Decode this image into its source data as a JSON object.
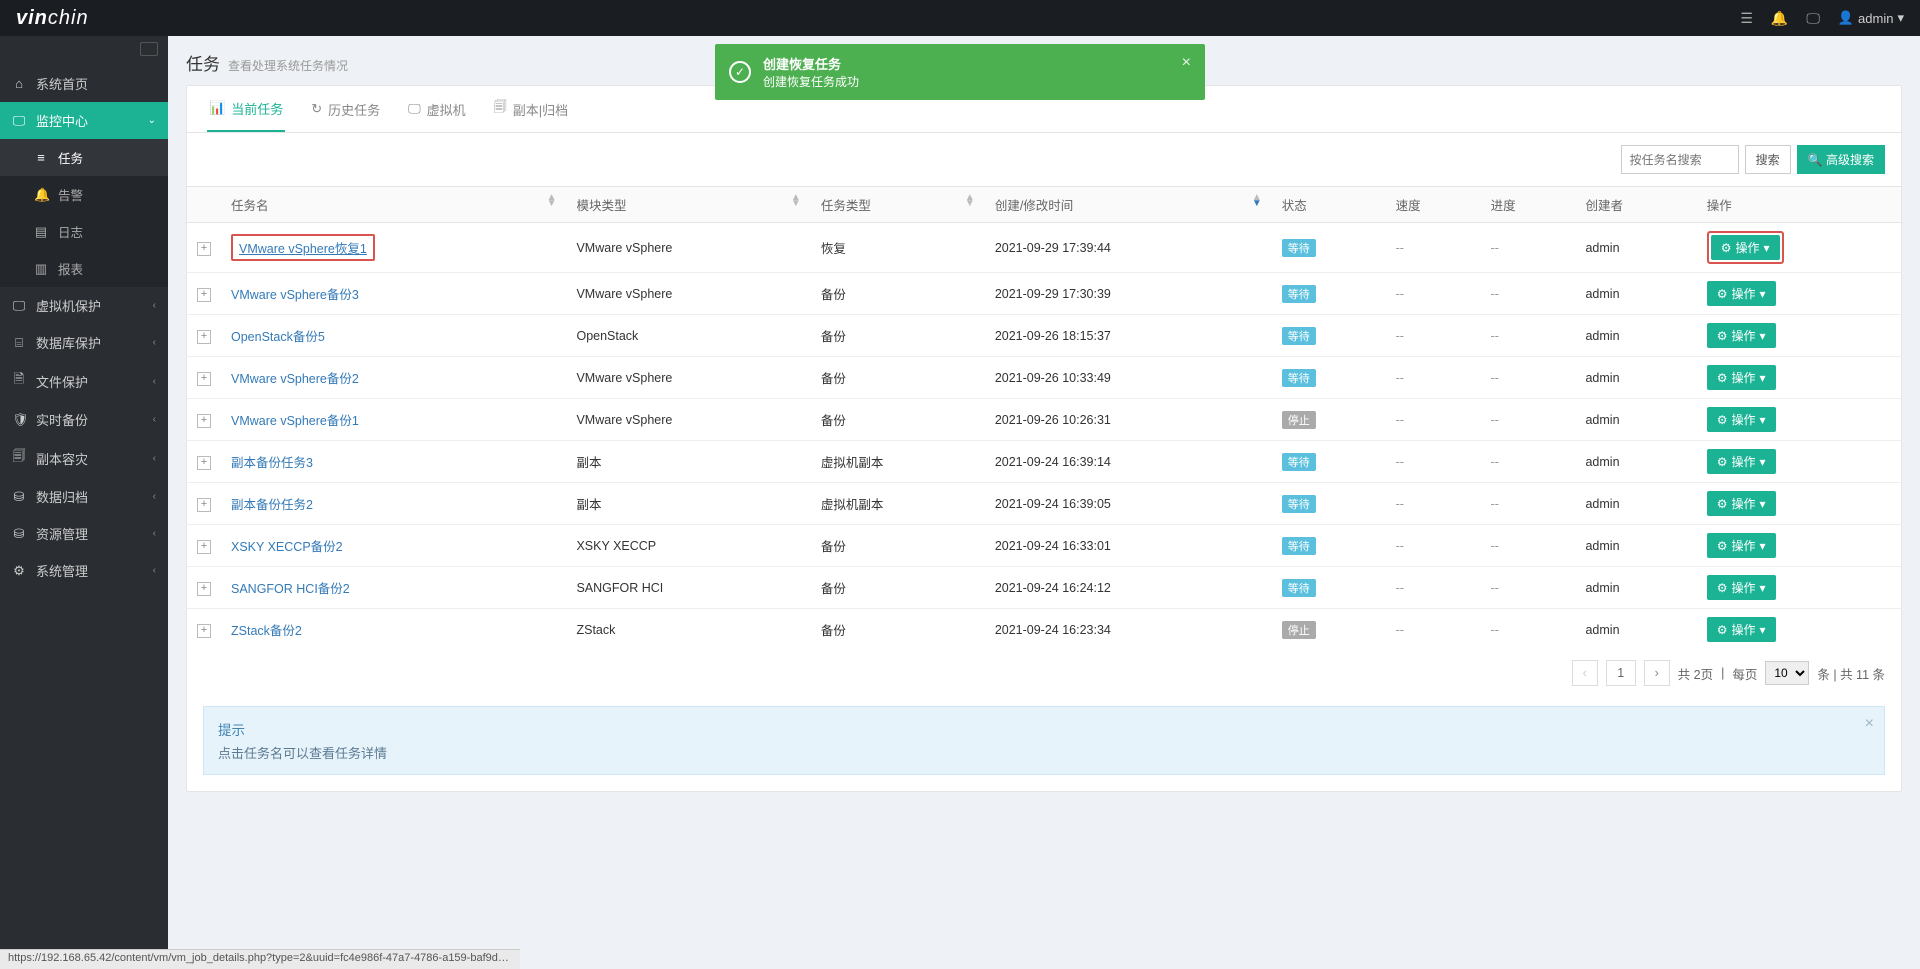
{
  "header": {
    "logo_html": "vinchin",
    "user": "admin"
  },
  "sidebar": {
    "items": [
      {
        "icon": "⌂",
        "label": "系统首页",
        "children": null
      },
      {
        "icon": "🖵",
        "label": "监控中心",
        "active": true,
        "children": [
          {
            "icon": "≡",
            "label": "任务",
            "active": true
          },
          {
            "icon": "🔔",
            "label": "告警"
          },
          {
            "icon": "▤",
            "label": "日志"
          },
          {
            "icon": "▥",
            "label": "报表"
          }
        ]
      },
      {
        "icon": "🖵",
        "label": "虚拟机保护"
      },
      {
        "icon": "⌸",
        "label": "数据库保护"
      },
      {
        "icon": "🗎",
        "label": "文件保护"
      },
      {
        "icon": "🛡",
        "label": "实时备份"
      },
      {
        "icon": "🗐",
        "label": "副本容灾"
      },
      {
        "icon": "⛁",
        "label": "数据归档"
      },
      {
        "icon": "⛁",
        "label": "资源管理"
      },
      {
        "icon": "⚙",
        "label": "系统管理"
      }
    ]
  },
  "toast": {
    "title": "创建恢复任务",
    "msg": "创建恢复任务成功"
  },
  "page": {
    "title": "任务",
    "subtitle": "查看处理系统任务情况"
  },
  "tabs": [
    {
      "icon": "📊",
      "label": "当前任务",
      "active": true
    },
    {
      "icon": "↻",
      "label": "历史任务"
    },
    {
      "icon": "🖵",
      "label": "虚拟机"
    },
    {
      "icon": "🗐",
      "label": "副本|归档"
    }
  ],
  "search": {
    "placeholder": "按任务名搜索",
    "btn": "搜索",
    "adv": "高级搜索"
  },
  "table": {
    "columns": [
      "任务名",
      "模块类型",
      "任务类型",
      "创建/修改时间",
      "状态",
      "速度",
      "进度",
      "创建者",
      "操作"
    ],
    "action_label": "操作",
    "rows": [
      {
        "name": "VMware vSphere恢复1",
        "module": "VMware vSphere",
        "type": "恢复",
        "time": "2021-09-29 17:39:44",
        "status": "等待",
        "status_cls": "wait",
        "speed": "--",
        "progress": "--",
        "creator": "admin",
        "highlight": true
      },
      {
        "name": "VMware vSphere备份3",
        "module": "VMware vSphere",
        "type": "备份",
        "time": "2021-09-29 17:30:39",
        "status": "等待",
        "status_cls": "wait",
        "speed": "--",
        "progress": "--",
        "creator": "admin"
      },
      {
        "name": "OpenStack备份5",
        "module": "OpenStack",
        "type": "备份",
        "time": "2021-09-26 18:15:37",
        "status": "等待",
        "status_cls": "wait",
        "speed": "--",
        "progress": "--",
        "creator": "admin"
      },
      {
        "name": "VMware vSphere备份2",
        "module": "VMware vSphere",
        "type": "备份",
        "time": "2021-09-26 10:33:49",
        "status": "等待",
        "status_cls": "wait",
        "speed": "--",
        "progress": "--",
        "creator": "admin"
      },
      {
        "name": "VMware vSphere备份1",
        "module": "VMware vSphere",
        "type": "备份",
        "time": "2021-09-26 10:26:31",
        "status": "停止",
        "status_cls": "stop",
        "speed": "--",
        "progress": "--",
        "creator": "admin"
      },
      {
        "name": "副本备份任务3",
        "module": "副本",
        "type": "虚拟机副本",
        "time": "2021-09-24 16:39:14",
        "status": "等待",
        "status_cls": "wait",
        "speed": "--",
        "progress": "--",
        "creator": "admin"
      },
      {
        "name": "副本备份任务2",
        "module": "副本",
        "type": "虚拟机副本",
        "time": "2021-09-24 16:39:05",
        "status": "等待",
        "status_cls": "wait",
        "speed": "--",
        "progress": "--",
        "creator": "admin"
      },
      {
        "name": "XSKY XECCP备份2",
        "module": "XSKY XECCP",
        "type": "备份",
        "time": "2021-09-24 16:33:01",
        "status": "等待",
        "status_cls": "wait",
        "speed": "--",
        "progress": "--",
        "creator": "admin"
      },
      {
        "name": "SANGFOR HCI备份2",
        "module": "SANGFOR HCI",
        "type": "备份",
        "time": "2021-09-24 16:24:12",
        "status": "等待",
        "status_cls": "wait",
        "speed": "--",
        "progress": "--",
        "creator": "admin"
      },
      {
        "name": "ZStack备份2",
        "module": "ZStack",
        "type": "备份",
        "time": "2021-09-24 16:23:34",
        "status": "停止",
        "status_cls": "stop",
        "speed": "--",
        "progress": "--",
        "creator": "admin"
      }
    ]
  },
  "pager": {
    "current": "1",
    "pages_label": "共 2页",
    "per_page_label": "每页",
    "per_page": "10",
    "total_label": "条 | 共 11 条"
  },
  "tip": {
    "title": "提示",
    "text": "点击任务名可以查看任务详情"
  },
  "status_bar": "https://192.168.65.42/content/vm/vm_job_details.php?type=2&uuid=fc4e986f-47a7-4786-a159-baf9db25f..."
}
